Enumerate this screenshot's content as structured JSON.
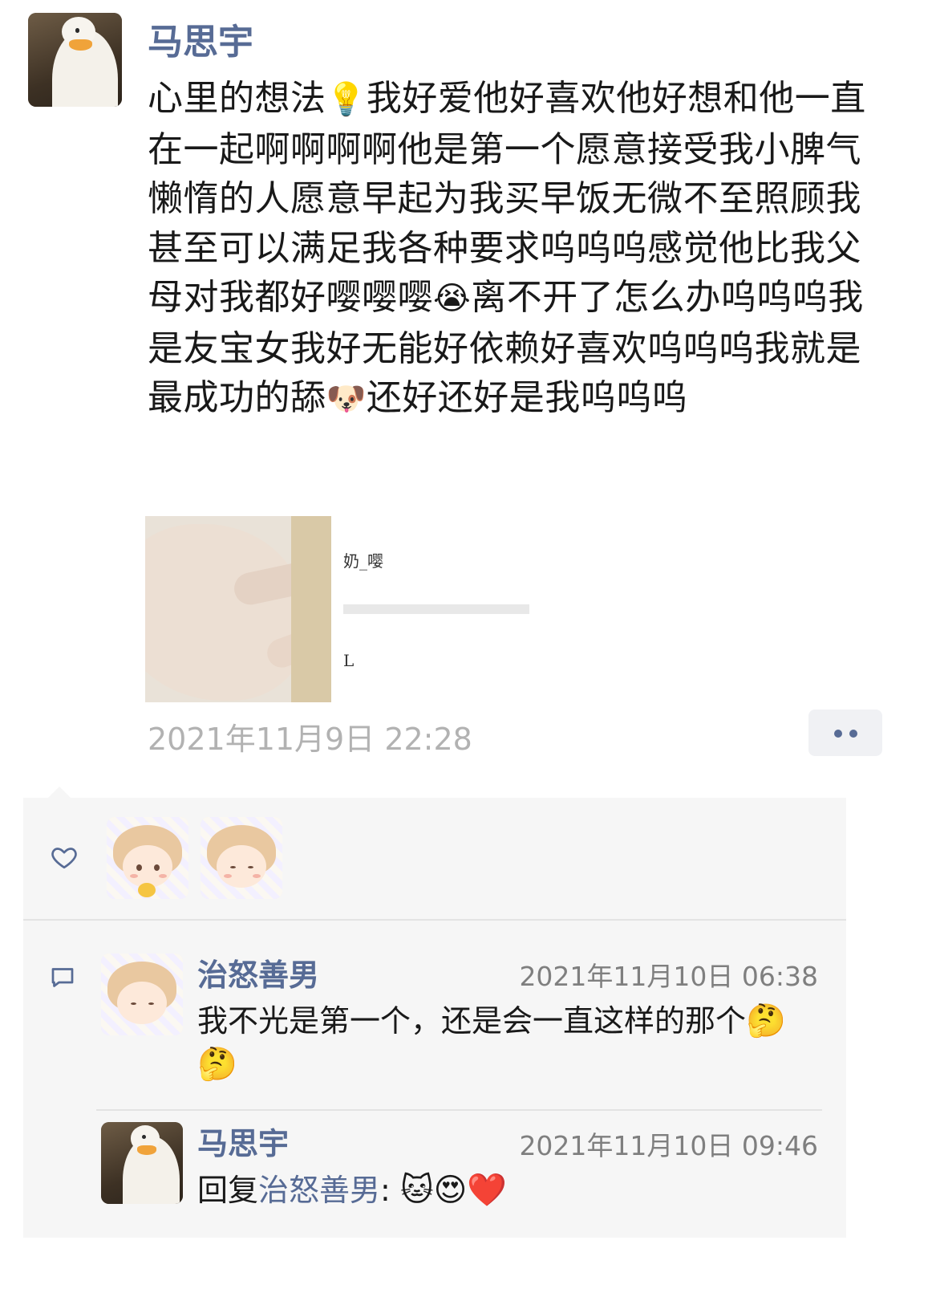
{
  "post": {
    "author": "马思宇",
    "text_before_bulb": "心里的想法",
    "bulb_emoji": "💡",
    "text_segment_1": "我好爱他好喜欢他好想和他一直在一起啊啊啊啊他是第一个愿意接受我小脾气懒惰的人愿意早起为我买早饭无微不至照顾我甚至可以满足我各种要求呜呜呜感觉他比我父母对我都好嘤嘤嘤",
    "cry_emoji": "😭",
    "text_segment_2": "离不开了怎么办呜呜呜我是友宝女我好无能好依赖好喜欢呜呜呜我就是最成功的舔",
    "dog_emoji": "🐶",
    "text_segment_3": "还好还好是我呜呜呜",
    "photo2_text_top": "奶_嘤",
    "photo2_text_bottom": "L",
    "timestamp": "2021年11月9日 22:28"
  },
  "likes": {
    "icon": "heart-outline-icon"
  },
  "comments": [
    {
      "author": "治怒善男",
      "time": "2021年11月10日 06:38",
      "text": "我不光是第一个，还是会一直这样的那个",
      "emojis": "🤔🤔"
    },
    {
      "author": "马思宇",
      "time": "2021年11月10日 09:46",
      "reply_prefix": "回复",
      "reply_to": "治怒善男",
      "colon": ":",
      "emojis": "🐱😍❤️"
    }
  ],
  "colors": {
    "link": "#576b95",
    "panel": "#f6f6f6",
    "time": "#b2b2b2"
  }
}
